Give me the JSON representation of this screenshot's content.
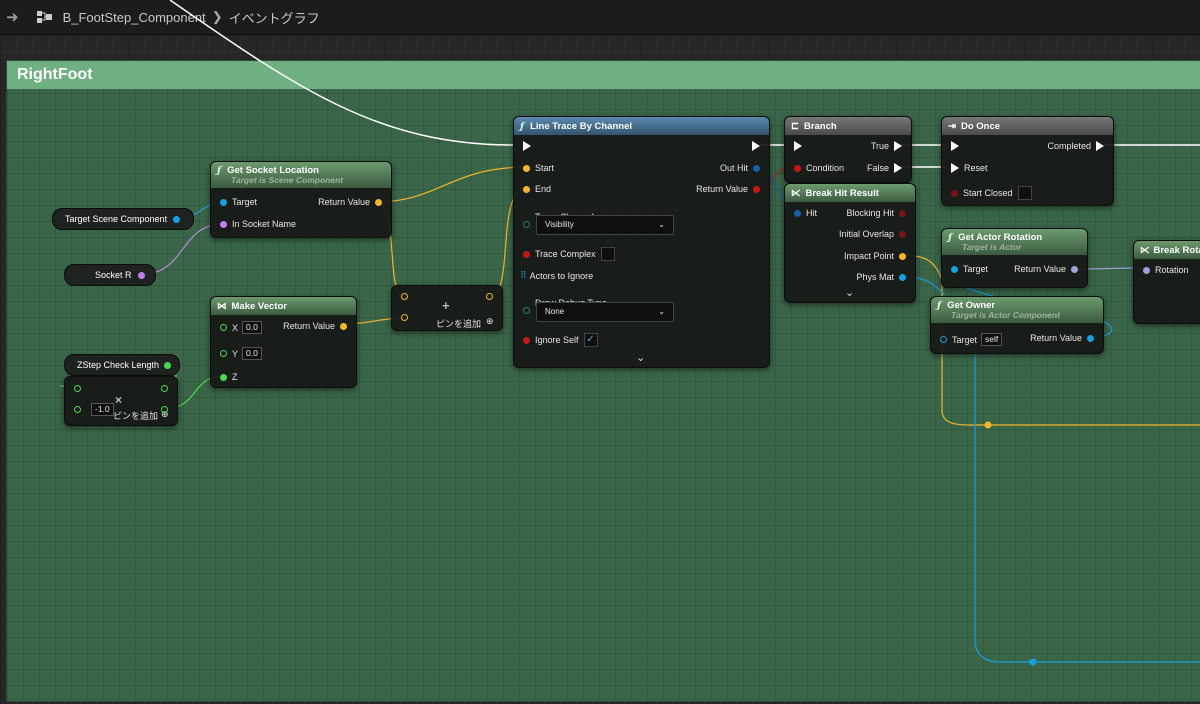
{
  "breadcrumb": {
    "component": "B_FootStep_Component",
    "graph": "イベントグラフ"
  },
  "comment": {
    "title": "RightFoot"
  },
  "colors": {
    "exec": "#ffffff",
    "struct": "#f2b52b",
    "object": "#16a0e0",
    "name": "#c47ff0",
    "float": "#4cd84c",
    "bool": "#c41818",
    "enum": "#1f7a7a"
  },
  "nodes": {
    "get_socket": {
      "title": "Get Socket Location",
      "sub": "Target is Scene Component",
      "in1": "Target",
      "in2": "In Socket Name",
      "out": "Return Value"
    },
    "target_scene": {
      "label": "Target Scene Component"
    },
    "socket_r": {
      "label": "Socket R"
    },
    "make_vector": {
      "title": "Make Vector",
      "x": "X",
      "x_val": "0.0",
      "y": "Y",
      "y_val": "0.0",
      "z": "Z",
      "out": "Return Value"
    },
    "zstep": {
      "label": "ZStep Check Length"
    },
    "multiply": {
      "val": "-1.0",
      "add_pin": "ピンを追加"
    },
    "add": {
      "add_pin": "ピンを追加"
    },
    "line_trace": {
      "title": "Line Trace By Channel",
      "start": "Start",
      "end": "End",
      "out_hit": "Out Hit",
      "ret": "Return Value",
      "trace_channel": "Trace Channel",
      "trace_channel_val": "Visibility",
      "trace_complex": "Trace Complex",
      "actors": "Actors to Ignore",
      "draw_debug": "Draw Debug Type",
      "draw_debug_val": "None",
      "ignore_self": "Ignore Self"
    },
    "branch": {
      "title": "Branch",
      "cond": "Condition",
      "true": "True",
      "false": "False"
    },
    "break_hit": {
      "title": "Break Hit Result",
      "hit": "Hit",
      "blocking": "Blocking Hit",
      "initial": "Initial Overlap",
      "impact": "Impact Point",
      "phys": "Phys Mat"
    },
    "do_once": {
      "title": "Do Once",
      "completed": "Completed",
      "reset": "Reset",
      "start_closed": "Start Closed"
    },
    "get_actor_rot": {
      "title": "Get Actor Rotation",
      "sub": "Target is Actor",
      "target": "Target",
      "ret": "Return Value"
    },
    "get_owner": {
      "title": "Get Owner",
      "sub": "Target is Actor Component",
      "target": "Target",
      "self": "self",
      "ret": "Return Value"
    },
    "break_rot": {
      "title": "Break Rota",
      "rot": "Rotation"
    }
  }
}
